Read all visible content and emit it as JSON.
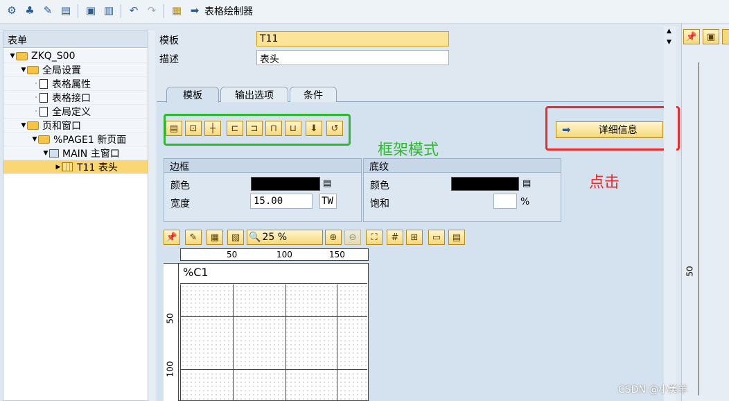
{
  "toolbar": {
    "title": "表格绘制器"
  },
  "tree": {
    "header": "表单",
    "items": [
      {
        "label": "ZKQ_S00"
      },
      {
        "label": "全局设置"
      },
      {
        "label": "表格属性"
      },
      {
        "label": "表格接口"
      },
      {
        "label": "全局定义"
      },
      {
        "label": "页和窗口"
      },
      {
        "label": "%PAGE1 新页面"
      },
      {
        "label": "MAIN 主窗口"
      },
      {
        "label": "T11 表头"
      }
    ]
  },
  "form": {
    "template_label": "模板",
    "template_value": "T11",
    "desc_label": "描述",
    "desc_value": "表头"
  },
  "tabs": [
    {
      "label": "模板"
    },
    {
      "label": "输出选项"
    },
    {
      "label": "条件"
    }
  ],
  "annotations": {
    "frame_mode": "框架模式",
    "click": "点击"
  },
  "detail_button": "详细信息",
  "border_group": {
    "title": "边框",
    "color_label": "颜色",
    "width_label": "宽度",
    "width_value": "15.00",
    "unit": "TW"
  },
  "shading_group": {
    "title": "底纹",
    "color_label": "颜色",
    "saturation_label": "饱和",
    "percent": "%"
  },
  "zoom": "25 %",
  "ruler": {
    "h1": "50",
    "h2": "100",
    "h3": "150",
    "v1": "50",
    "v2": "100",
    "right": "50"
  },
  "cell_label": "%C1",
  "watermark": "CSDN @小美羊",
  "colors": {
    "green": "#2dbb2d",
    "red": "#ee2a2a",
    "selection": "#fbd774"
  }
}
